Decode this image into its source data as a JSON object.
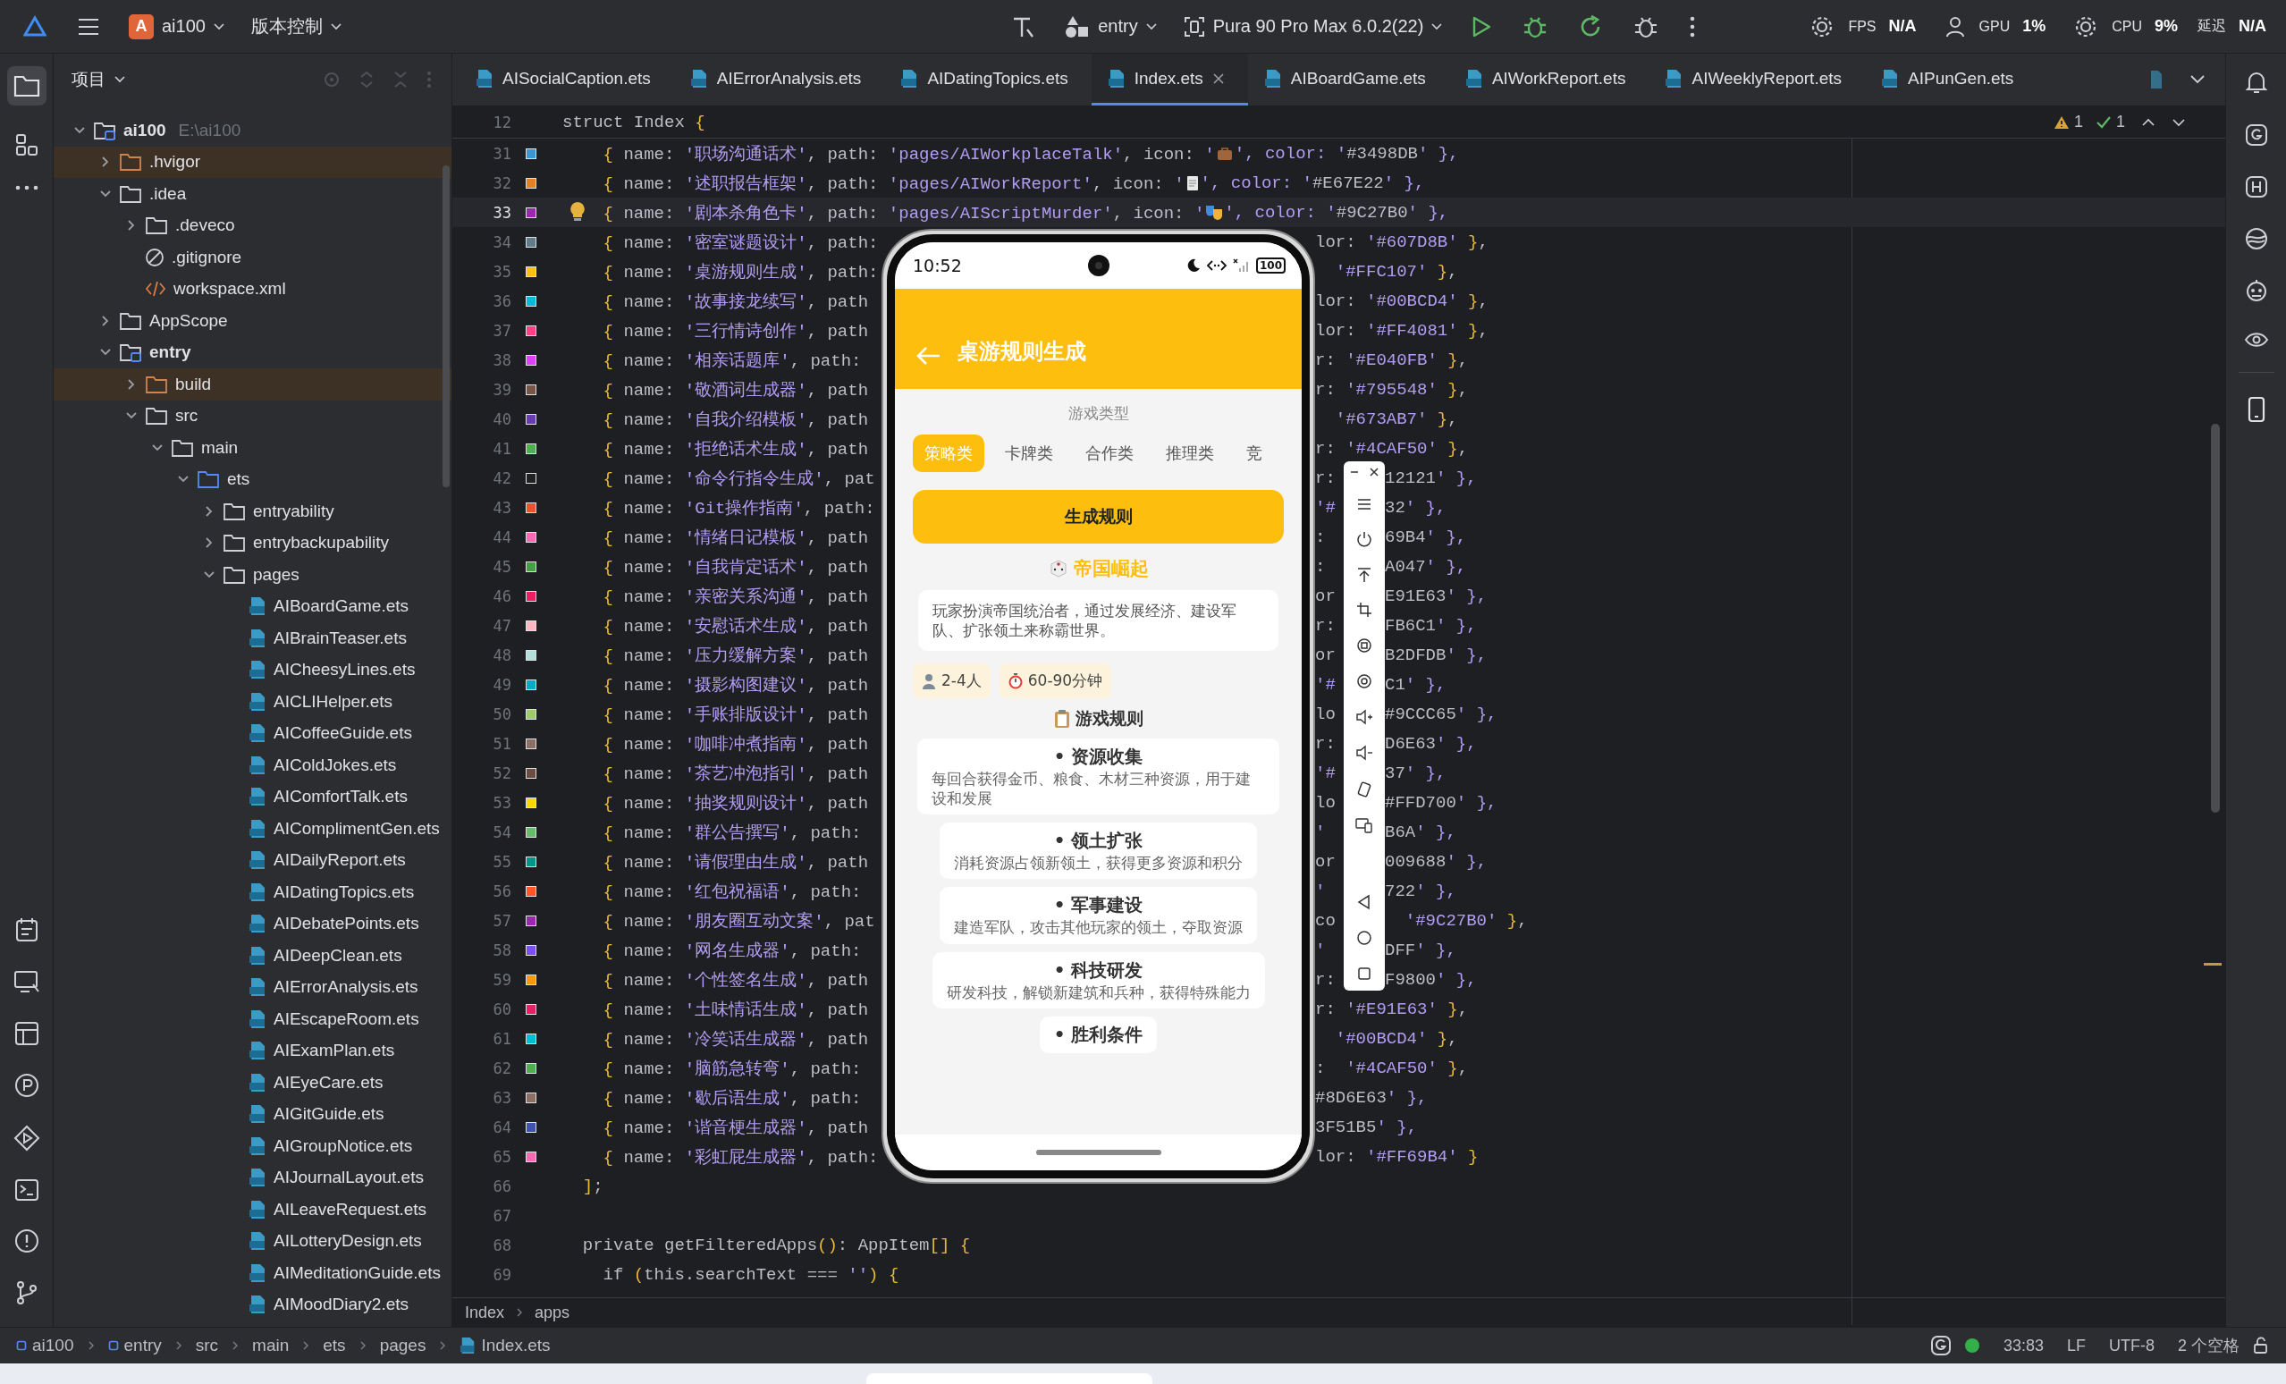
{
  "title_bar": {
    "project_badge": "A",
    "project": "ai100",
    "vcs": "版本控制",
    "run_config": "entry",
    "device": "Pura 90 Pro Max 6.0.2(22)",
    "stats": [
      {
        "label": "FPS",
        "value": "N/A"
      },
      {
        "label": "GPU",
        "value": "1%"
      },
      {
        "label": "CPU",
        "value": "9%"
      },
      {
        "label": "延迟",
        "value": "N/A"
      }
    ]
  },
  "project_panel": {
    "title": "项目",
    "tree": [
      {
        "label": "ai100",
        "kind": "module",
        "expanded": true,
        "note": "E:\\ai100",
        "children": [
          {
            "label": ".hvigor",
            "kind": "excluded-folder",
            "expanded": false
          },
          {
            "label": ".idea",
            "kind": "folder",
            "expanded": true,
            "children": [
              {
                "label": ".deveco",
                "kind": "folder",
                "expanded": false
              },
              {
                "label": ".gitignore",
                "kind": "ignore"
              },
              {
                "label": "workspace.xml",
                "kind": "xml"
              }
            ]
          },
          {
            "label": "AppScope",
            "kind": "folder",
            "expanded": false
          },
          {
            "label": "entry",
            "kind": "module",
            "expanded": true,
            "children": [
              {
                "label": "build",
                "kind": "excluded-folder",
                "expanded": false
              },
              {
                "label": "src",
                "kind": "folder",
                "expanded": true,
                "children": [
                  {
                    "label": "main",
                    "kind": "folder",
                    "expanded": true,
                    "children": [
                      {
                        "label": "ets",
                        "kind": "source-folder",
                        "expanded": true,
                        "children": [
                          {
                            "label": "entryability",
                            "kind": "folder",
                            "expanded": false
                          },
                          {
                            "label": "entrybackupability",
                            "kind": "folder",
                            "expanded": false
                          },
                          {
                            "label": "pages",
                            "kind": "folder",
                            "expanded": true,
                            "children": [
                              {
                                "label": "AIBoardGame.ets",
                                "kind": "ets"
                              },
                              {
                                "label": "AIBrainTeaser.ets",
                                "kind": "ets"
                              },
                              {
                                "label": "AICheesyLines.ets",
                                "kind": "ets"
                              },
                              {
                                "label": "AICLIHelper.ets",
                                "kind": "ets"
                              },
                              {
                                "label": "AICoffeeGuide.ets",
                                "kind": "ets"
                              },
                              {
                                "label": "AIColdJokes.ets",
                                "kind": "ets"
                              },
                              {
                                "label": "AIComfortTalk.ets",
                                "kind": "ets"
                              },
                              {
                                "label": "AIComplimentGen.ets",
                                "kind": "ets"
                              },
                              {
                                "label": "AIDailyReport.ets",
                                "kind": "ets"
                              },
                              {
                                "label": "AIDatingTopics.ets",
                                "kind": "ets"
                              },
                              {
                                "label": "AIDebatePoints.ets",
                                "kind": "ets"
                              },
                              {
                                "label": "AIDeepClean.ets",
                                "kind": "ets"
                              },
                              {
                                "label": "AIErrorAnalysis.ets",
                                "kind": "ets"
                              },
                              {
                                "label": "AIEscapeRoom.ets",
                                "kind": "ets"
                              },
                              {
                                "label": "AIExamPlan.ets",
                                "kind": "ets"
                              },
                              {
                                "label": "AIEyeCare.ets",
                                "kind": "ets"
                              },
                              {
                                "label": "AIGitGuide.ets",
                                "kind": "ets"
                              },
                              {
                                "label": "AIGroupNotice.ets",
                                "kind": "ets"
                              },
                              {
                                "label": "AIJournalLayout.ets",
                                "kind": "ets"
                              },
                              {
                                "label": "AILeaveRequest.ets",
                                "kind": "ets"
                              },
                              {
                                "label": "AILotteryDesign.ets",
                                "kind": "ets"
                              },
                              {
                                "label": "AIMeditationGuide.ets",
                                "kind": "ets"
                              },
                              {
                                "label": "AIMoodDiary2.ets",
                                "kind": "ets"
                              }
                            ]
                          }
                        ]
                      }
                    ]
                  }
                ]
              }
            ]
          }
        ]
      }
    ]
  },
  "tabs": [
    {
      "label": "AISocialCaption.ets",
      "selected": false
    },
    {
      "label": "AIErrorAnalysis.ets",
      "selected": false
    },
    {
      "label": "AIDatingTopics.ets",
      "selected": false
    },
    {
      "label": "Index.ets",
      "selected": true
    },
    {
      "label": "AIBoardGame.ets",
      "selected": false
    },
    {
      "label": "AIWorkReport.ets",
      "selected": false
    },
    {
      "label": "AIWeeklyReport.ets",
      "selected": false
    },
    {
      "label": "AIPunGen.ets",
      "selected": false
    }
  ],
  "editor": {
    "sticky": {
      "number": "12",
      "text": "struct Index {"
    },
    "problems": {
      "warnings": "1",
      "checks": "1"
    },
    "lines": [
      {
        "number": "31",
        "color": "#3498DB",
        "current": false,
        "kind": "icon",
        "text": "    { name: '职场沟通话术', path: 'pages/AIWorkplaceTalk', icon: '",
        "after": "', color: '#3498DB' },"
      },
      {
        "number": "32",
        "color": "#E67E22",
        "current": false,
        "kind": "icon",
        "text": "    { name: '述职报告框架', path: 'pages/AIWorkReport', icon: '",
        "after": "', color: '#E67E22' },"
      },
      {
        "number": "33",
        "color": "#9C27B0",
        "current": true,
        "kind": "icon",
        "text": "    { name: '剧本杀角色卡', path: 'pages/AIScriptMurder', icon: '",
        "after": "', color: '#9C27B0' },"
      },
      {
        "number": "34",
        "color": "#607D8B",
        "current": false,
        "kind": "split",
        "left": "    { name: '密室谜题设计', path:",
        "right": "lor: '#607D8B' },"
      },
      {
        "number": "35",
        "color": "#FFC107",
        "current": false,
        "kind": "split",
        "left": "    { name: '桌游规则生成', path:",
        "right": "  '#FFC107' },"
      },
      {
        "number": "36",
        "color": "#00BCD4",
        "current": false,
        "kind": "split",
        "left": "    { name: '故事接龙续写', path",
        "right": "lor: '#00BCD4' },"
      },
      {
        "number": "37",
        "color": "#FF4081",
        "current": false,
        "kind": "split",
        "left": "    { name: '三行情诗创作', path",
        "right": "lor: '#FF4081' },"
      },
      {
        "number": "38",
        "color": "#E040FB",
        "current": false,
        "kind": "split",
        "left": "    { name: '相亲话题库', path:",
        "right": "r: '#E040FB' },"
      },
      {
        "number": "39",
        "color": "#795548",
        "current": false,
        "kind": "split",
        "left": "    { name: '敬酒词生成器', path",
        "right": "r: '#795548' },"
      },
      {
        "number": "40",
        "color": "#673AB7",
        "current": false,
        "kind": "split",
        "left": "    { name: '自我介绍模板', path",
        "right": "  '#673AB7' },"
      },
      {
        "number": "41",
        "color": "#4CAF50",
        "current": false,
        "kind": "split",
        "left": "    { name: '拒绝话术生成', path",
        "right": "r: '#4CAF50' },"
      },
      {
        "number": "42",
        "color": "#212121",
        "current": false,
        "kind": "split3",
        "left": "    { name: '命令行指令生成', pat",
        "mid": "r:",
        "right": "12121' },"
      },
      {
        "number": "43",
        "color": "#F05032",
        "current": false,
        "kind": "split3",
        "left": "    { name: 'Git操作指南', path:",
        "mid": "'#",
        "right": "32' },"
      },
      {
        "number": "44",
        "color": "#FF69B4",
        "current": false,
        "kind": "split3",
        "left": "    { name: '情绪日记模板', path",
        "mid": ":",
        "right": "69B4' },"
      },
      {
        "number": "45",
        "color": "#43A047",
        "current": false,
        "kind": "split3",
        "left": "    { name: '自我肯定话术', path",
        "mid": ":",
        "right": "A047' },"
      },
      {
        "number": "46",
        "color": "#E91E63",
        "current": false,
        "kind": "split3",
        "left": "    { name: '亲密关系沟通', path",
        "mid": "or",
        "right": "E91E63' },"
      },
      {
        "number": "47",
        "color": "#FFB6C1",
        "current": false,
        "kind": "split3",
        "left": "    { name: '安慰话术生成', path",
        "mid": "r:",
        "right": "FB6C1' },"
      },
      {
        "number": "48",
        "color": "#B2DFDB",
        "current": false,
        "kind": "split3",
        "left": "    { name: '压力缓解方案', path",
        "mid": "or",
        "right": "B2DFDB' },"
      },
      {
        "number": "49",
        "color": "#00ACC1",
        "current": false,
        "kind": "split3",
        "left": "    { name: '摄影构图建议', path",
        "mid": "'#",
        "right": "C1' },"
      },
      {
        "number": "50",
        "color": "#9CCC65",
        "current": false,
        "kind": "split3",
        "left": "    { name: '手账排版设计', path",
        "mid": "lo",
        "right": "#9CCC65' },"
      },
      {
        "number": "51",
        "color": "#8D6E63",
        "current": false,
        "kind": "split3",
        "left": "    { name: '咖啡冲煮指南', path",
        "mid": "r:",
        "right": "D6E63' },"
      },
      {
        "number": "52",
        "color": "#6D4C41",
        "current": false,
        "kind": "split3",
        "left": "    { name: '茶艺冲泡指引', path",
        "mid": "'#",
        "right": "37' },"
      },
      {
        "number": "53",
        "color": "#FFD700",
        "current": false,
        "kind": "split3",
        "left": "    { name: '抽奖规则设计', path",
        "mid": "lo",
        "right": "#FFD700' },"
      },
      {
        "number": "54",
        "color": "#66BB6A",
        "current": false,
        "kind": "split3",
        "left": "    { name: '群公告撰写', path:",
        "mid": "'",
        "right": "B6A' },"
      },
      {
        "number": "55",
        "color": "#009688",
        "current": false,
        "kind": "split3",
        "left": "    { name: '请假理由生成', path",
        "mid": "or",
        "right": "009688' },"
      },
      {
        "number": "56",
        "color": "#FF5722",
        "current": false,
        "kind": "split3",
        "left": "    { name: '红包祝福语', path:",
        "mid": "'",
        "right": "722' },"
      },
      {
        "number": "57",
        "color": "#9C27B0",
        "current": false,
        "kind": "split3",
        "left": "    { name: '朋友圈互动文案', pat",
        "mid": "co",
        "right": "  '#9C27B0' },"
      },
      {
        "number": "58",
        "color": "#7C4DFF",
        "current": false,
        "kind": "split3",
        "left": "    { name: '网名生成器', path:",
        "mid": "'",
        "right": "DFF' },"
      },
      {
        "number": "59",
        "color": "#FF9800",
        "current": false,
        "kind": "split3",
        "left": "    { name: '个性签名生成', path",
        "mid": "r:",
        "right": "F9800' },"
      },
      {
        "number": "60",
        "color": "#E91E63",
        "current": false,
        "kind": "split",
        "left": "    { name: '土味情话生成', path",
        "right": "r: '#E91E63' },"
      },
      {
        "number": "61",
        "color": "#00BCD4",
        "current": false,
        "kind": "split",
        "left": "    { name: '冷笑话生成器', path",
        "right": "  '#00BCD4' },"
      },
      {
        "number": "62",
        "color": "#4CAF50",
        "current": false,
        "kind": "split",
        "left": "    { name: '脑筋急转弯', path:",
        "right": ":  '#4CAF50' },"
      },
      {
        "number": "63",
        "color": "#8D6E63",
        "current": false,
        "kind": "split",
        "left": "    { name: '歇后语生成', path:",
        "right": "#8D6E63' },"
      },
      {
        "number": "64",
        "color": "#3F51B5",
        "current": false,
        "kind": "split",
        "left": "    { name: '谐音梗生成器', path",
        "right": "3F51B5' },"
      },
      {
        "number": "65",
        "color": "#FF69B4",
        "current": false,
        "kind": "split",
        "left": "    { name: '彩虹屁生成器', path:",
        "right": "lor: '#FF69B4' }"
      },
      {
        "number": "66",
        "kind": "plain",
        "current": false,
        "text": "  ];"
      },
      {
        "number": "67",
        "kind": "blank",
        "current": false
      },
      {
        "number": "68",
        "kind": "plain",
        "current": false,
        "text": "  private getFilteredApps(): AppItem[] {"
      },
      {
        "number": "69",
        "kind": "plain",
        "current": false,
        "text": "    if (this.searchText === '') {"
      }
    ],
    "breadcrumb": [
      "Index",
      "apps"
    ]
  },
  "phone": {
    "time": "10:52",
    "battery": "100",
    "title": "桌游规则生成",
    "type_label": "游戏类型",
    "types": [
      {
        "label": "策略类",
        "selected": true
      },
      {
        "label": "卡牌类",
        "selected": false
      },
      {
        "label": "合作类",
        "selected": false
      },
      {
        "label": "推理类",
        "selected": false
      },
      {
        "label": "竞",
        "selected": false
      }
    ],
    "generate_button": "生成规则",
    "game": {
      "name": "帝国崛起",
      "description": "玩家扮演帝国统治者，通过发展经济、建设军队、扩张领土来称霸世界。",
      "players": "2-4人",
      "duration": "60-90分钟"
    },
    "rules_title": "游戏规则",
    "rules": [
      {
        "title": "• 资源收集",
        "description": "每回合获得金币、粮食、木材三种资源，用于建设和发展"
      },
      {
        "title": "• 领土扩张",
        "description": "消耗资源占领新领土，获得更多资源和积分"
      },
      {
        "title": "• 军事建设",
        "description": "建造军队，攻击其他玩家的领土，夺取资源"
      },
      {
        "title": "• 科技研发",
        "description": "研发科技，解锁新建筑和兵种，获得特殊能力"
      },
      {
        "title": "• 胜利条件"
      }
    ]
  },
  "status_bar": {
    "path": [
      "ai100",
      "entry",
      "src",
      "main",
      "ets",
      "pages",
      "Index.ets"
    ],
    "position": "33:83",
    "line_ending": "LF",
    "encoding": "UTF-8",
    "indent": "2 个空格"
  }
}
